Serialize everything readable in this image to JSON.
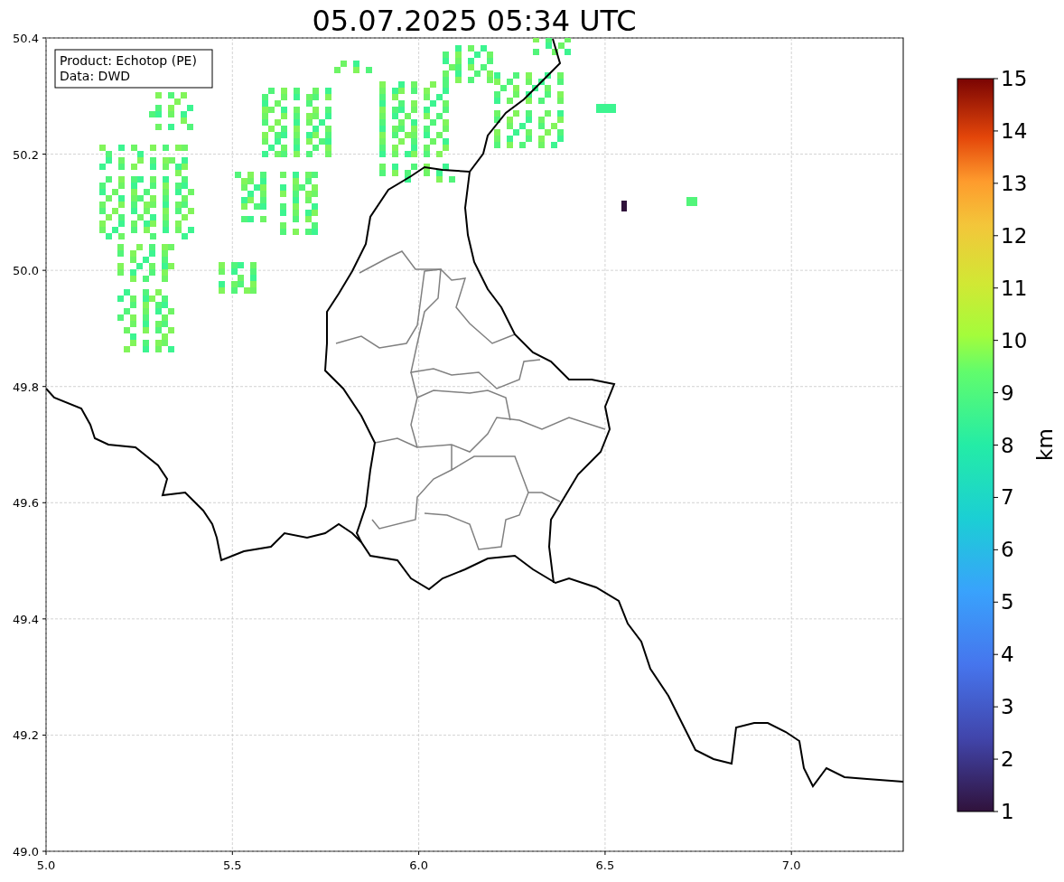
{
  "title": "05.07.2025 05:34 UTC",
  "info_box": {
    "lines": [
      "Product: Echotop (PE)",
      "Data: DWD"
    ]
  },
  "map": {
    "xticks": [
      "5.0",
      "5.5",
      "6.0",
      "6.5",
      "7.0"
    ],
    "yticks": [
      "50.4",
      "50.2",
      "50.0",
      "49.8",
      "49.6",
      "49.4",
      "49.2",
      "49.0"
    ]
  },
  "colorbar": {
    "ticks": [
      "15",
      "14",
      "13",
      "12",
      "11",
      "10",
      "9",
      "8",
      "7",
      "6",
      "5",
      "4",
      "3",
      "2",
      "1"
    ],
    "label": "km"
  }
}
